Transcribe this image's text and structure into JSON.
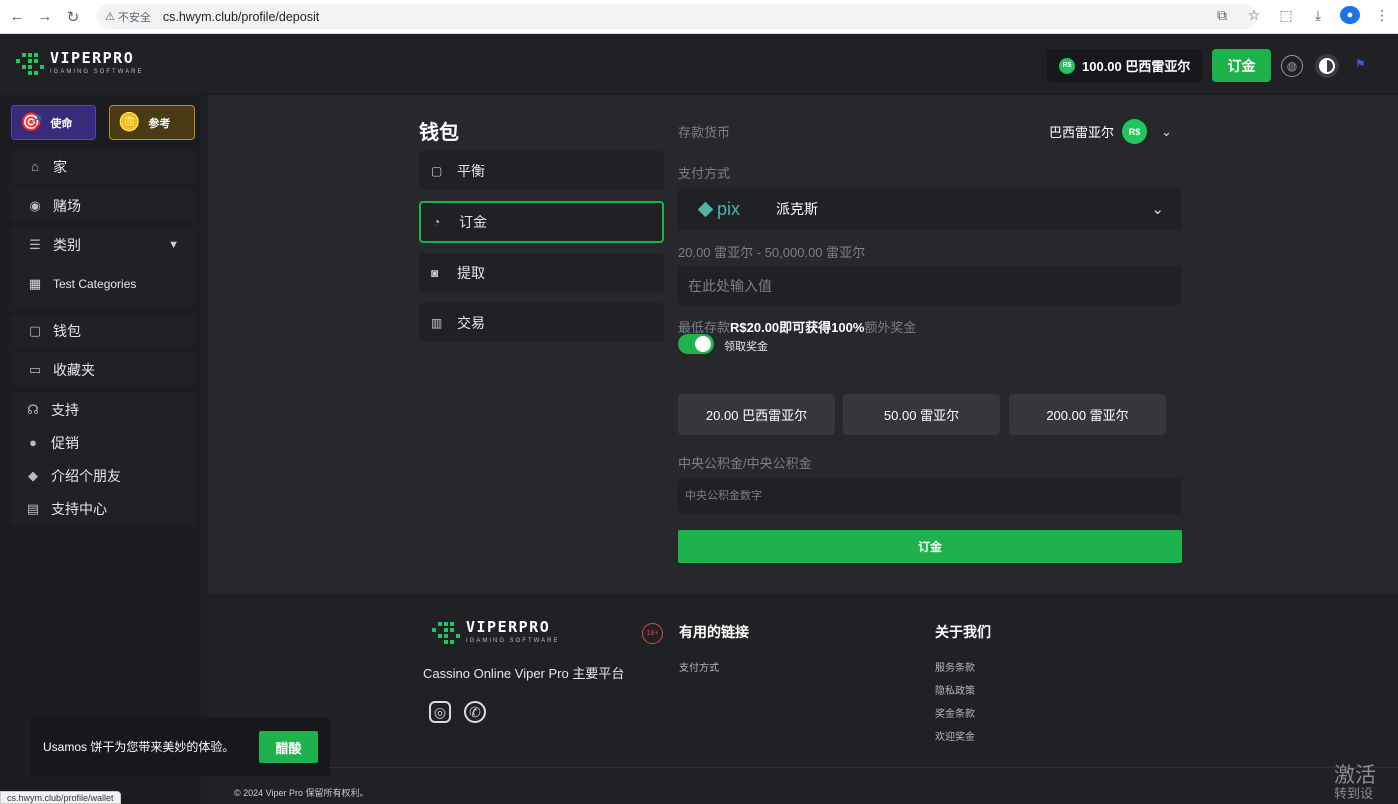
{
  "browser": {
    "insecure_label": "不安全",
    "url": "cs.hwym.club/profile/deposit",
    "status_url": "cs.hwym.club/profile/wallet"
  },
  "header": {
    "logo_big": "VIPERPRO",
    "logo_small": "IGAMING SOFTWARE",
    "balance": "100.00 巴西雷亚尔",
    "currency_badge": "R$",
    "deposit_button": "订金"
  },
  "sidebar": {
    "promo_mission": "使命",
    "promo_ref": "参考",
    "items": [
      {
        "label": "家",
        "icon": "home-icon"
      },
      {
        "label": "赌场",
        "icon": "gamepad-icon"
      },
      {
        "label": "类别",
        "icon": "list-icon"
      },
      {
        "label": "Test Categories",
        "icon": "category-image-icon"
      },
      {
        "label": "钱包",
        "icon": "wallet-icon"
      },
      {
        "label": "收藏夹",
        "icon": "folder-icon"
      },
      {
        "label": "支持",
        "icon": "headset-icon"
      },
      {
        "label": "促销",
        "icon": "promo-icon"
      },
      {
        "label": "介绍个朋友",
        "icon": "ticket-icon"
      },
      {
        "label": "支持中心",
        "icon": "help-center-icon"
      }
    ]
  },
  "wallet": {
    "title": "钱包",
    "menu": [
      {
        "label": "平衡",
        "icon": "wallet-icon"
      },
      {
        "label": "订金",
        "icon": "piggy-bank-icon"
      },
      {
        "label": "提取",
        "icon": "withdraw-icon"
      },
      {
        "label": "交易",
        "icon": "chart-icon"
      }
    ]
  },
  "deposit": {
    "currency_label": "存款货币",
    "currency_value": "巴西雷亚尔",
    "currency_badge": "R$",
    "payment_label": "支付方式",
    "payment_logo": "pix",
    "payment_value": "派克斯",
    "range_label": "20.00 雷亚尔 - 50,000.00 雷亚尔",
    "amount_placeholder": "在此处输入值",
    "bonus_prefix": "最低存款",
    "bonus_bold": "R$20.00即可获得100%",
    "bonus_suffix": "额外奖金",
    "toggle_label": "领取奖金",
    "quick_amounts": [
      "20.00 巴西雷亚尔",
      "50.00 雷亚尔",
      "200.00 雷亚尔"
    ],
    "cpf_label": "中央公积金/中央公积金",
    "cpf_placeholder": "中央公积金数字",
    "submit": "订金"
  },
  "footer": {
    "tagline": "Cassino Online Viper Pro 主要平台",
    "age_badge": "18+",
    "useful_title": "有用的链接",
    "useful_links": [
      "支付方式"
    ],
    "about_title": "关于我们",
    "about_links": [
      "服务条款",
      "隐私政策",
      "奖金条款",
      "欢迎奖金"
    ],
    "copyright": "© 2024 Viper Pro 保留所有权利。"
  },
  "cookie": {
    "text": "Usamos 饼干为您带来美妙的体验。",
    "button": "醋酸"
  },
  "watermark": {
    "line1": "激活",
    "line2": "转到设"
  }
}
